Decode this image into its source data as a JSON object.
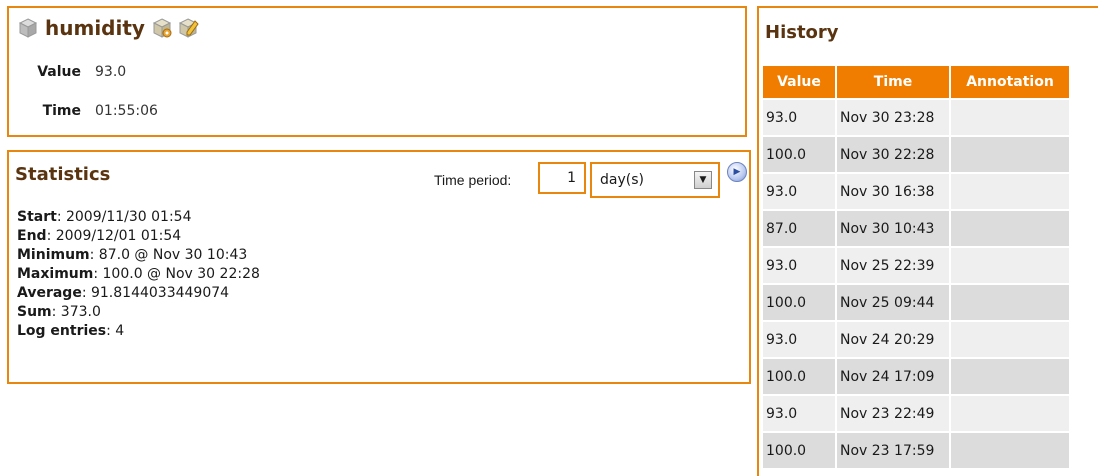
{
  "sensor": {
    "name": "humidity",
    "value_label": "Value",
    "value": "93.0",
    "time_label": "Time",
    "time": "01:55:06"
  },
  "statistics": {
    "title": "Statistics",
    "period_label": "Time period:",
    "period_value": "1",
    "period_unit": "day(s)",
    "items": [
      {
        "label": "Start",
        "value": ": 2009/11/30 01:54"
      },
      {
        "label": "End",
        "value": ": 2009/12/01 01:54"
      },
      {
        "label": "Minimum",
        "value": ": 87.0 @ Nov 30 10:43"
      },
      {
        "label": "Maximum",
        "value": ": 100.0 @ Nov 30 22:28"
      },
      {
        "label": "Average",
        "value": ": 91.8144033449074"
      },
      {
        "label": "Sum",
        "value": ": 373.0"
      },
      {
        "label": "Log entries",
        "value": ": 4"
      }
    ]
  },
  "history": {
    "title": "History",
    "columns": [
      "Value",
      "Time",
      "Annotation"
    ],
    "rows": [
      {
        "value": "93.0",
        "time": "Nov 30 23:28",
        "annotation": ""
      },
      {
        "value": "100.0",
        "time": "Nov 30 22:28",
        "annotation": ""
      },
      {
        "value": "93.0",
        "time": "Nov 30 16:38",
        "annotation": ""
      },
      {
        "value": "87.0",
        "time": "Nov 30 10:43",
        "annotation": ""
      },
      {
        "value": "93.0",
        "time": "Nov 25 22:39",
        "annotation": ""
      },
      {
        "value": "100.0",
        "time": "Nov 25 09:44",
        "annotation": ""
      },
      {
        "value": "93.0",
        "time": "Nov 24 20:29",
        "annotation": ""
      },
      {
        "value": "100.0",
        "time": "Nov 24 17:09",
        "annotation": ""
      },
      {
        "value": "93.0",
        "time": "Nov 23 22:49",
        "annotation": ""
      },
      {
        "value": "100.0",
        "time": "Nov 23 17:59",
        "annotation": ""
      }
    ]
  },
  "icons": {
    "sensor_icon": "cube-icon",
    "settings_icon": "cube-gear-icon",
    "edit_icon": "edit-pencil-icon",
    "go_icon": "play-arrow-icon",
    "dropdown_icon": "chevron-down-icon"
  },
  "colors": {
    "accent": "#f07d00",
    "border": "#e8870f",
    "title": "#5a3410",
    "row_odd": "#efefef",
    "row_even": "#dcdcdc"
  }
}
